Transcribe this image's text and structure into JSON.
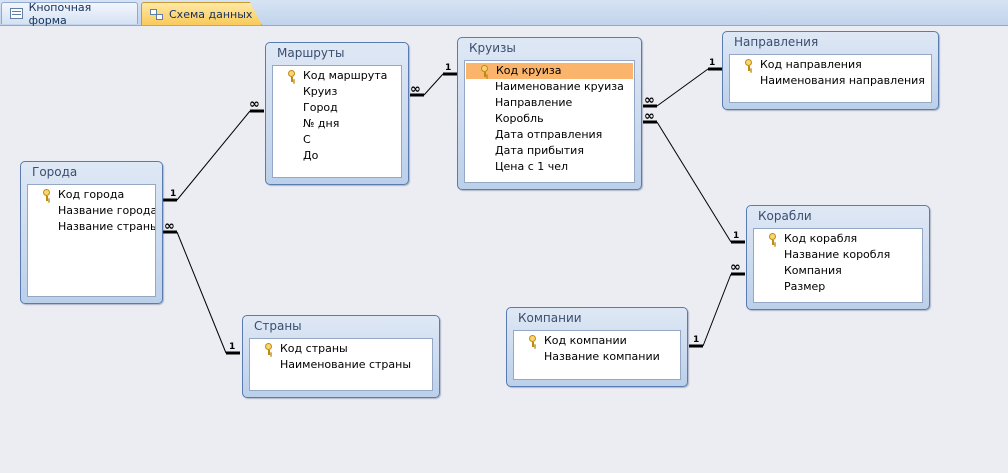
{
  "tabs": [
    {
      "label": "Кнопочная форма",
      "icon": "form-icon",
      "active": false
    },
    {
      "label": "Схема данных",
      "icon": "schema-icon",
      "active": true
    }
  ],
  "tables": {
    "marshruty": {
      "title": "Маршруты",
      "fields": [
        "Код маршрута",
        "Круиз",
        "Город",
        "№ дня",
        "С",
        "До"
      ],
      "key": "Код маршрута"
    },
    "kruizy": {
      "title": "Круизы",
      "fields": [
        "Код круиза",
        "Наименование круиза",
        "Направление",
        "Коробль",
        "Дата отправления",
        "Дата прибытия",
        "Цена с 1 чел"
      ],
      "key": "Код круиза",
      "selected": "Код круиза"
    },
    "napravleniya": {
      "title": "Направления",
      "fields": [
        "Код направления",
        "Наименования направления"
      ],
      "key": "Код направления"
    },
    "goroda": {
      "title": "Города",
      "fields": [
        "Код города",
        "Название города",
        "Название страны"
      ],
      "key": "Код города"
    },
    "korabli": {
      "title": "Корабли",
      "fields": [
        "Код корабля",
        "Название коробля",
        "Компания",
        "Размер"
      ],
      "key": "Код корабля"
    },
    "strany": {
      "title": "Страны",
      "fields": [
        "Код страны",
        "Наименование страны"
      ],
      "key": "Код страны"
    },
    "kompanii": {
      "title": "Компании",
      "fields": [
        "Код компании",
        "Название компании"
      ],
      "key": "Код компании"
    }
  },
  "relationships": [
    {
      "from": "Города.Код города",
      "to": "Маршруты.Город",
      "one": "1",
      "many": "∞"
    },
    {
      "from": "Круизы.Код круиза",
      "to": "Маршруты.Круиз",
      "one": "1",
      "many": "∞"
    },
    {
      "from": "Направления.Код направления",
      "to": "Круизы.Направление",
      "one": "1",
      "many": "∞"
    },
    {
      "from": "Корабли.Код корабля",
      "to": "Круизы.Коробль",
      "one": "1",
      "many": "∞"
    },
    {
      "from": "Страны.Код страны",
      "to": "Города.Название страны",
      "one": "1",
      "many": "∞"
    },
    {
      "from": "Компании.Код компании",
      "to": "Корабли.Компания",
      "one": "1",
      "many": "∞"
    }
  ],
  "colors": {
    "canvas": "#ebedf2",
    "selected_row": "#fbb46b",
    "active_tab": "#f9c95a",
    "window_border": "#5a7bb0"
  }
}
